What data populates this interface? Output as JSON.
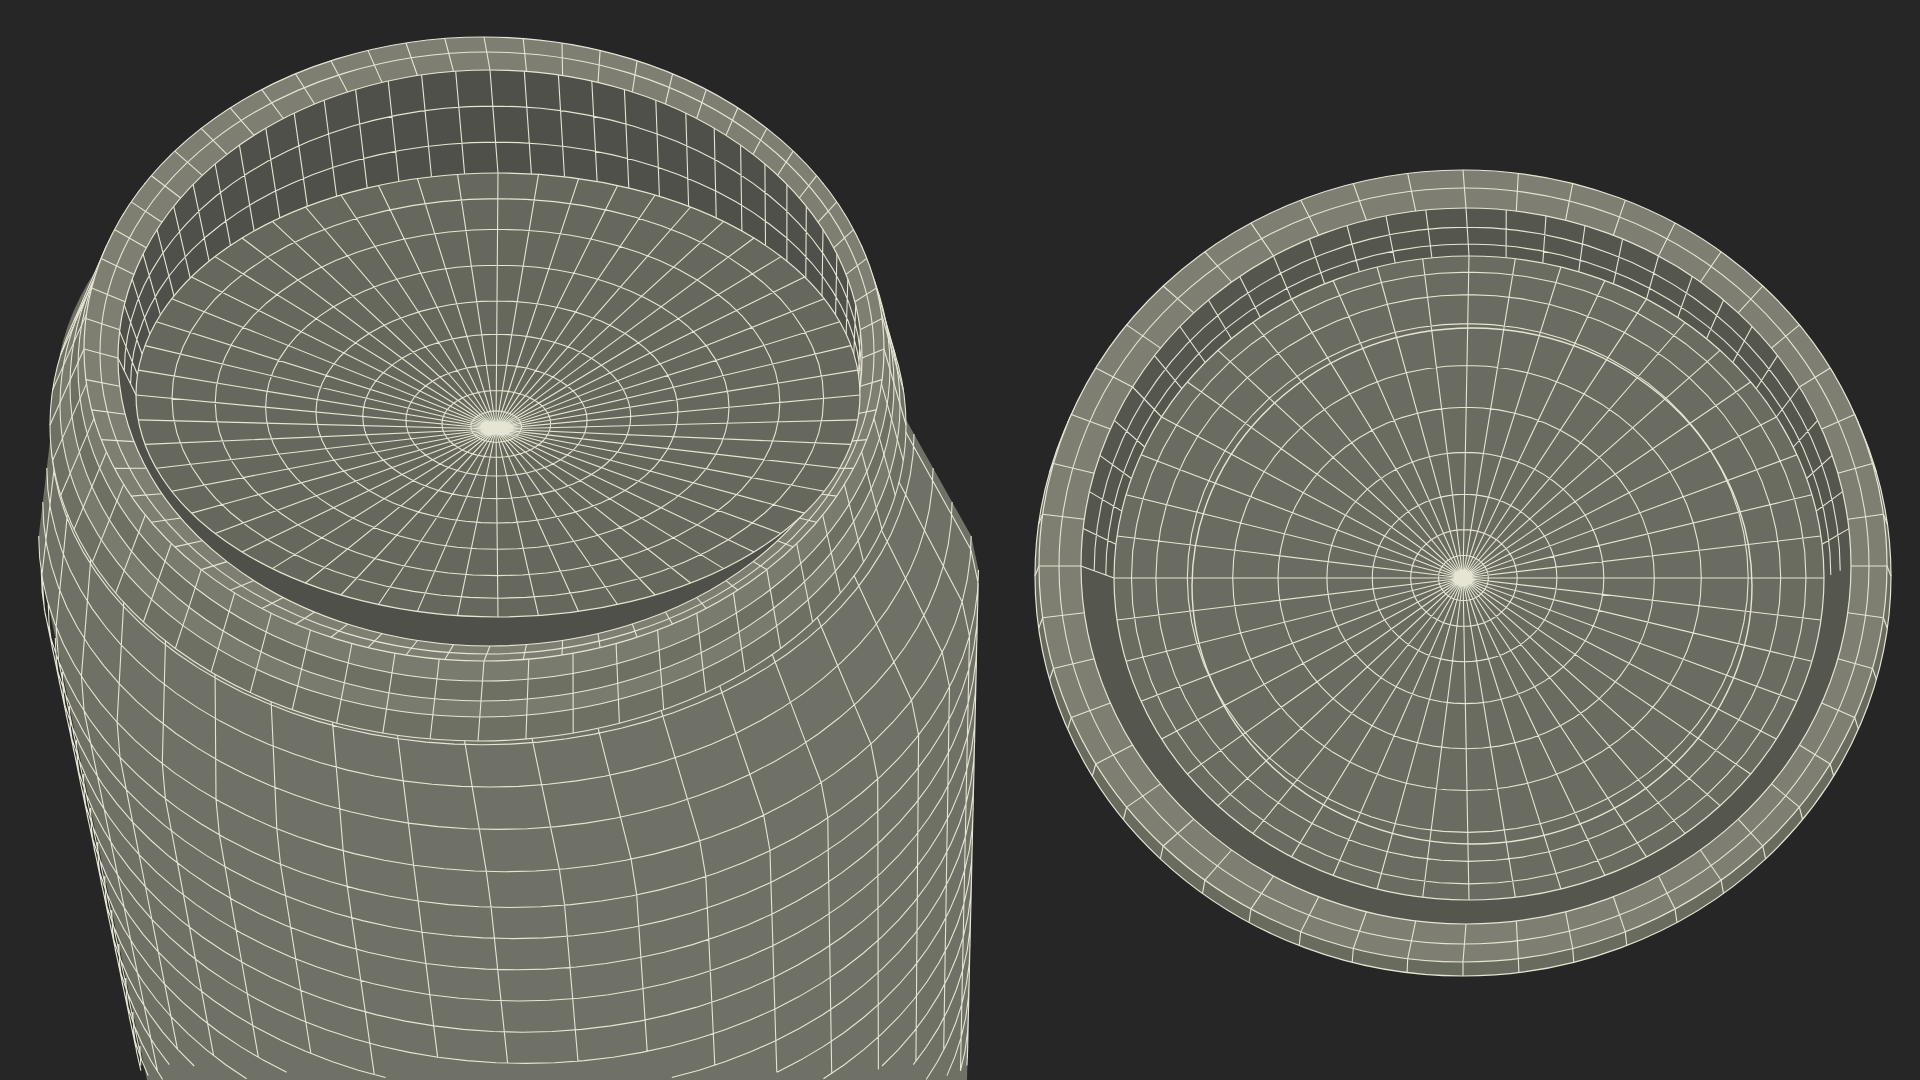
{
  "render": {
    "objects": [
      {
        "kind": "jar"
      },
      {
        "kind": "lid"
      }
    ]
  }
}
